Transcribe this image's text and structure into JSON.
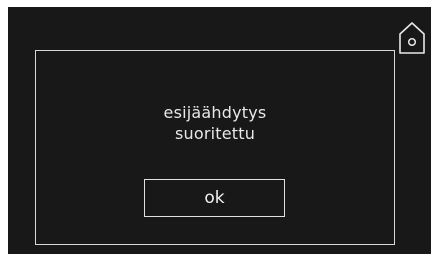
{
  "dialog": {
    "message_line1": "esijäähdytys",
    "message_line2": "suoritettu",
    "ok_label": "ok"
  },
  "home_button": {
    "icon": "home-icon"
  },
  "colors": {
    "screen_background": "#181818",
    "foreground": "#e8e8e8"
  }
}
